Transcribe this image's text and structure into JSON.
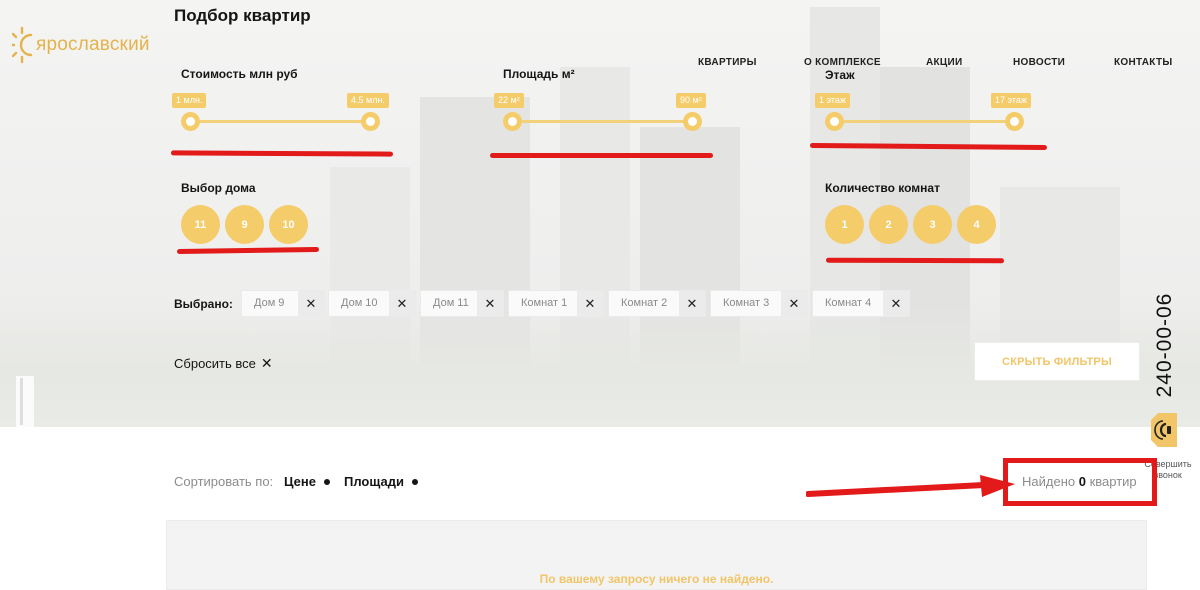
{
  "page_title": "Подбор квартир",
  "logo": {
    "text": "ярославский",
    "icon": "sun-logo-icon",
    "color": "#e4b34c"
  },
  "nav": [
    "КВАРТИРЫ",
    "О КОМПЛЕКСЕ",
    "АКЦИИ",
    "НОВОСТИ",
    "КОНТАКТЫ"
  ],
  "filters": {
    "price": {
      "label": "Стоимость млн руб",
      "min_label": "1 млн.",
      "max_label": "4.5 млн."
    },
    "area": {
      "label": "Площадь м²",
      "min_label": "22 м²",
      "max_label": "90 м²"
    },
    "floor": {
      "label": "Этаж",
      "min_label": "1 этаж",
      "max_label": "17 этаж"
    },
    "house": {
      "label": "Выбор дома",
      "options": [
        "11",
        "9",
        "10"
      ]
    },
    "rooms": {
      "label": "Количество комнат",
      "options": [
        "1",
        "2",
        "3",
        "4"
      ]
    }
  },
  "selected": {
    "label": "Выбрано:",
    "chips": [
      "Дом 9",
      "Дом 10",
      "Дом 11",
      "Комнат 1",
      "Комнат 2",
      "Комнат 3",
      "Комнат 4"
    ],
    "remove_glyph": "✕"
  },
  "reset": {
    "label": "Сбросить все",
    "glyph": "✕"
  },
  "hide_filters": "СКРЫТЬ ФИЛЬТРЫ",
  "phone": "240-00-06",
  "call": {
    "text": "Совершить звонок",
    "icon": "phone-ring-icon"
  },
  "sort": {
    "label": "Сортировать по:",
    "options": [
      "Цене",
      "Площади"
    ]
  },
  "found": {
    "prefix": "Найдено",
    "count": "0",
    "suffix": "квартир"
  },
  "no_results": "По вашему запросу ничего не найдено.",
  "colors": {
    "accent": "#f5cc6a",
    "annotation_red": "#e21a1a",
    "text_dark": "#151515"
  }
}
